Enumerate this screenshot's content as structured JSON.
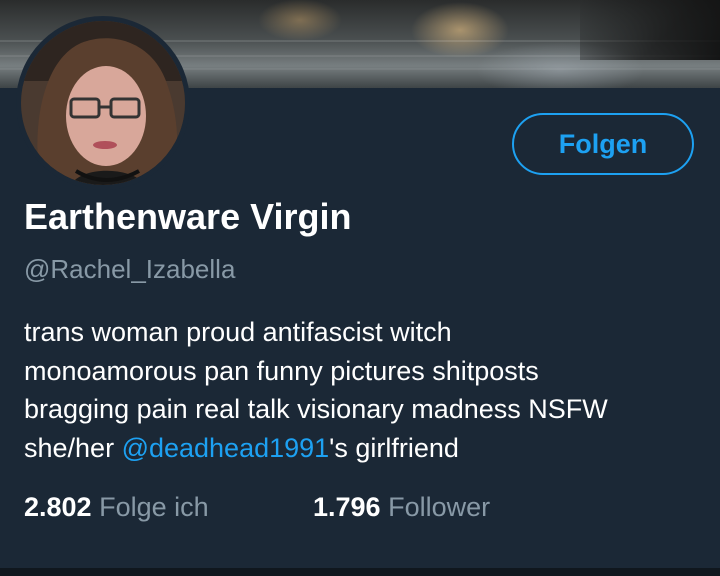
{
  "profile": {
    "display_name": "Earthenware Virgin",
    "handle": "@Rachel_Izabella",
    "bio": {
      "line1": "trans woman proud antifascist witch",
      "line2": "monoamorous pan funny pictures shitposts",
      "line3": "bragging pain real talk visionary madness NSFW",
      "line4_prefix": "she/her ",
      "line4_mention": "@deadhead1991",
      "line4_suffix": "'s girlfriend"
    },
    "follow_label": "Folgen",
    "following_count": "2.802",
    "following_label": "Folge ich",
    "followers_count": "1.796",
    "followers_label": "Follower"
  },
  "colors": {
    "background": "#1b2836",
    "accent": "#1da1f2",
    "secondary_text": "#8899a6"
  },
  "icons": {
    "avatar": "profile-photo",
    "banner": "header-photo-river-night"
  }
}
